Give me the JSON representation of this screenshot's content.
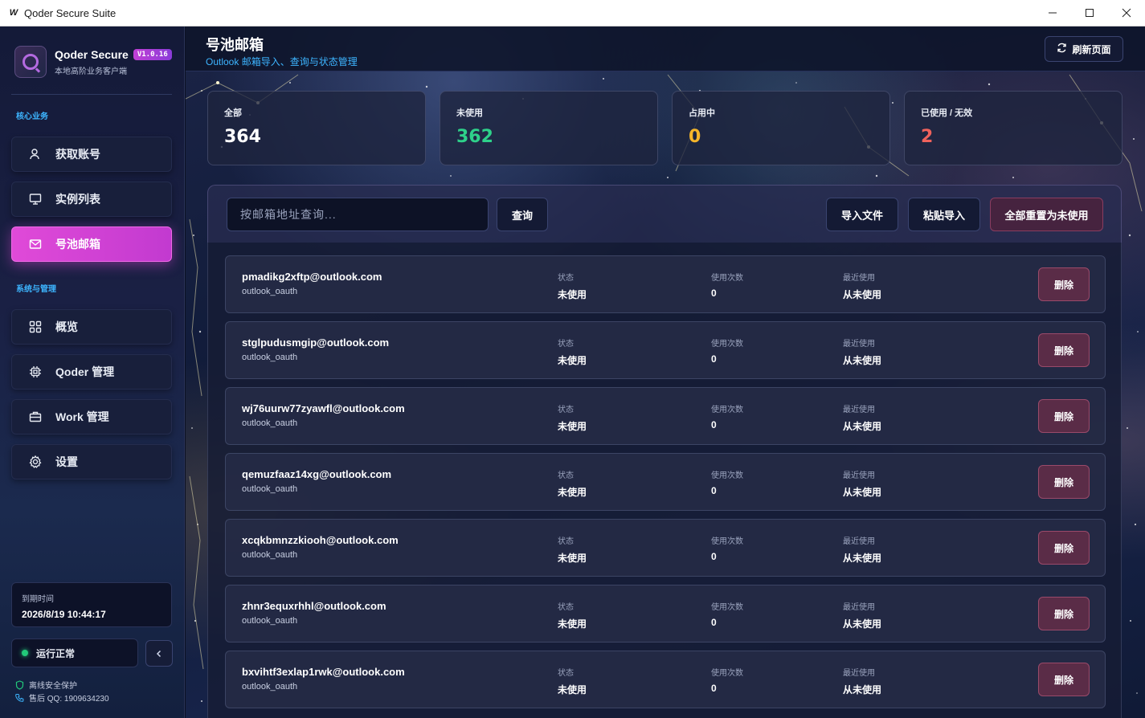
{
  "window": {
    "title": "Qoder Secure Suite",
    "app_icon_glyph": "W",
    "controls": [
      "minimize-icon",
      "maximize-icon",
      "close-icon"
    ]
  },
  "sidebar": {
    "brand_name": "Qoder Secure",
    "version": "V1.0.16",
    "brand_subtitle": "本地高阶业务客户端",
    "section_core": "核心业务",
    "section_system": "系统与管理",
    "items": [
      {
        "label": "获取账号",
        "icon": "user-icon",
        "active": false
      },
      {
        "label": "实例列表",
        "icon": "monitor-icon",
        "active": false
      },
      {
        "label": "号池邮箱",
        "icon": "mail-icon",
        "active": true
      },
      {
        "label": "概览",
        "icon": "grid-icon",
        "active": false
      },
      {
        "label": "Qoder 管理",
        "icon": "chip-icon",
        "active": false
      },
      {
        "label": "Work 管理",
        "icon": "briefcase-icon",
        "active": false
      },
      {
        "label": "设置",
        "icon": "gear-icon",
        "active": false
      }
    ],
    "expiry_label": "到期时间",
    "expiry_value": "2026/8/19 10:44:17",
    "status_text": "运行正常",
    "status_color": "#22c97a",
    "footer_security": "离线安全保护",
    "footer_support": "售后 QQ:  1909634230"
  },
  "header": {
    "title": "号池邮箱",
    "subtitle": "Outlook 邮箱导入、查询与状态管理",
    "refresh_label": "刷新页面"
  },
  "stats": [
    {
      "label": "全部",
      "value": "364",
      "color": "#ffffff"
    },
    {
      "label": "未使用",
      "value": "362",
      "color": "#2ed18a"
    },
    {
      "label": "占用中",
      "value": "0",
      "color": "#f5b52a"
    },
    {
      "label": "已使用 / 无效",
      "value": "2",
      "color": "#f0625c"
    }
  ],
  "toolbar": {
    "search_placeholder": "按邮箱地址查询...",
    "query_label": "查询",
    "import_file_label": "导入文件",
    "paste_import_label": "粘贴导入",
    "reset_all_label": "全部重置为未使用"
  },
  "columns": {
    "status": "状态",
    "use_count": "使用次数",
    "last_used": "最近使用"
  },
  "delete_label": "删除",
  "rows": [
    {
      "email": "pmadikg2xftp@outlook.com",
      "type": "outlook_oauth",
      "status": "未使用",
      "count": "0",
      "last_used": "从未使用"
    },
    {
      "email": "stglpudusmgip@outlook.com",
      "type": "outlook_oauth",
      "status": "未使用",
      "count": "0",
      "last_used": "从未使用"
    },
    {
      "email": "wj76uurw77zyawfl@outlook.com",
      "type": "outlook_oauth",
      "status": "未使用",
      "count": "0",
      "last_used": "从未使用"
    },
    {
      "email": "qemuzfaaz14xg@outlook.com",
      "type": "outlook_oauth",
      "status": "未使用",
      "count": "0",
      "last_used": "从未使用"
    },
    {
      "email": "xcqkbmnzzkiooh@outlook.com",
      "type": "outlook_oauth",
      "status": "未使用",
      "count": "0",
      "last_used": "从未使用"
    },
    {
      "email": "zhnr3equxrhhl@outlook.com",
      "type": "outlook_oauth",
      "status": "未使用",
      "count": "0",
      "last_used": "从未使用"
    },
    {
      "email": "bxvihtf3exlap1rwk@outlook.com",
      "type": "outlook_oauth",
      "status": "未使用",
      "count": "0",
      "last_used": "从未使用"
    }
  ]
}
